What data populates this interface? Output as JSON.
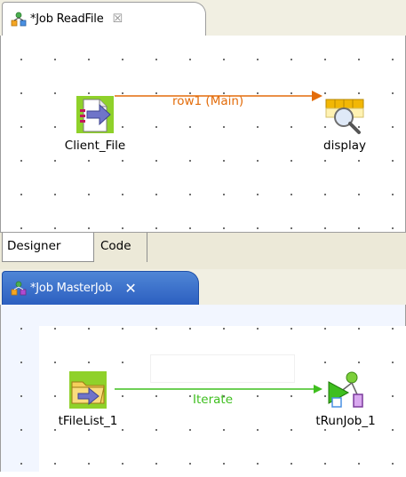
{
  "top_editor": {
    "tab_title": "*Job ReadFile",
    "close_glyph": "☒",
    "components": [
      {
        "label": "Client_File",
        "icon": "file-input-icon"
      },
      {
        "label": "display",
        "icon": "log-row-display-icon"
      }
    ],
    "link_label": "row1 (Main)",
    "link_color": "#e36c0a",
    "view_tabs": [
      "Designer",
      "Code"
    ]
  },
  "bottom_editor": {
    "tab_title": "*Job MasterJob",
    "close_glyph": "✕",
    "components": [
      {
        "label": "tFileList_1",
        "icon": "folder-file-list-icon"
      },
      {
        "label": "tRunJob_1",
        "icon": "run-job-icon"
      }
    ],
    "link_label": "Iterate",
    "link_color": "#3fbf1f",
    "active_tab_color": "#3a6fcc"
  }
}
